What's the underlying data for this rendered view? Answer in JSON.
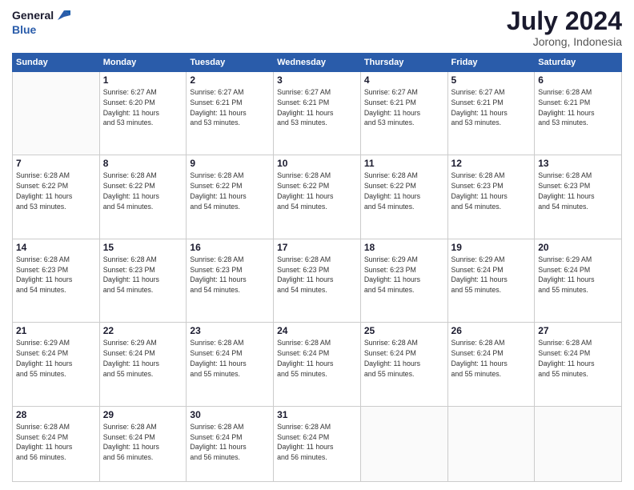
{
  "header": {
    "logo_line1": "General",
    "logo_line2": "Blue",
    "title": "July 2024",
    "subtitle": "Jorong, Indonesia"
  },
  "weekdays": [
    "Sunday",
    "Monday",
    "Tuesday",
    "Wednesday",
    "Thursday",
    "Friday",
    "Saturday"
  ],
  "weeks": [
    [
      {
        "day": "",
        "info": ""
      },
      {
        "day": "1",
        "info": "Sunrise: 6:27 AM\nSunset: 6:20 PM\nDaylight: 11 hours\nand 53 minutes."
      },
      {
        "day": "2",
        "info": "Sunrise: 6:27 AM\nSunset: 6:21 PM\nDaylight: 11 hours\nand 53 minutes."
      },
      {
        "day": "3",
        "info": "Sunrise: 6:27 AM\nSunset: 6:21 PM\nDaylight: 11 hours\nand 53 minutes."
      },
      {
        "day": "4",
        "info": "Sunrise: 6:27 AM\nSunset: 6:21 PM\nDaylight: 11 hours\nand 53 minutes."
      },
      {
        "day": "5",
        "info": "Sunrise: 6:27 AM\nSunset: 6:21 PM\nDaylight: 11 hours\nand 53 minutes."
      },
      {
        "day": "6",
        "info": "Sunrise: 6:28 AM\nSunset: 6:21 PM\nDaylight: 11 hours\nand 53 minutes."
      }
    ],
    [
      {
        "day": "7",
        "info": "Sunrise: 6:28 AM\nSunset: 6:22 PM\nDaylight: 11 hours\nand 53 minutes."
      },
      {
        "day": "8",
        "info": "Sunrise: 6:28 AM\nSunset: 6:22 PM\nDaylight: 11 hours\nand 54 minutes."
      },
      {
        "day": "9",
        "info": "Sunrise: 6:28 AM\nSunset: 6:22 PM\nDaylight: 11 hours\nand 54 minutes."
      },
      {
        "day": "10",
        "info": "Sunrise: 6:28 AM\nSunset: 6:22 PM\nDaylight: 11 hours\nand 54 minutes."
      },
      {
        "day": "11",
        "info": "Sunrise: 6:28 AM\nSunset: 6:22 PM\nDaylight: 11 hours\nand 54 minutes."
      },
      {
        "day": "12",
        "info": "Sunrise: 6:28 AM\nSunset: 6:23 PM\nDaylight: 11 hours\nand 54 minutes."
      },
      {
        "day": "13",
        "info": "Sunrise: 6:28 AM\nSunset: 6:23 PM\nDaylight: 11 hours\nand 54 minutes."
      }
    ],
    [
      {
        "day": "14",
        "info": "Sunrise: 6:28 AM\nSunset: 6:23 PM\nDaylight: 11 hours\nand 54 minutes."
      },
      {
        "day": "15",
        "info": "Sunrise: 6:28 AM\nSunset: 6:23 PM\nDaylight: 11 hours\nand 54 minutes."
      },
      {
        "day": "16",
        "info": "Sunrise: 6:28 AM\nSunset: 6:23 PM\nDaylight: 11 hours\nand 54 minutes."
      },
      {
        "day": "17",
        "info": "Sunrise: 6:28 AM\nSunset: 6:23 PM\nDaylight: 11 hours\nand 54 minutes."
      },
      {
        "day": "18",
        "info": "Sunrise: 6:29 AM\nSunset: 6:23 PM\nDaylight: 11 hours\nand 54 minutes."
      },
      {
        "day": "19",
        "info": "Sunrise: 6:29 AM\nSunset: 6:24 PM\nDaylight: 11 hours\nand 55 minutes."
      },
      {
        "day": "20",
        "info": "Sunrise: 6:29 AM\nSunset: 6:24 PM\nDaylight: 11 hours\nand 55 minutes."
      }
    ],
    [
      {
        "day": "21",
        "info": "Sunrise: 6:29 AM\nSunset: 6:24 PM\nDaylight: 11 hours\nand 55 minutes."
      },
      {
        "day": "22",
        "info": "Sunrise: 6:29 AM\nSunset: 6:24 PM\nDaylight: 11 hours\nand 55 minutes."
      },
      {
        "day": "23",
        "info": "Sunrise: 6:28 AM\nSunset: 6:24 PM\nDaylight: 11 hours\nand 55 minutes."
      },
      {
        "day": "24",
        "info": "Sunrise: 6:28 AM\nSunset: 6:24 PM\nDaylight: 11 hours\nand 55 minutes."
      },
      {
        "day": "25",
        "info": "Sunrise: 6:28 AM\nSunset: 6:24 PM\nDaylight: 11 hours\nand 55 minutes."
      },
      {
        "day": "26",
        "info": "Sunrise: 6:28 AM\nSunset: 6:24 PM\nDaylight: 11 hours\nand 55 minutes."
      },
      {
        "day": "27",
        "info": "Sunrise: 6:28 AM\nSunset: 6:24 PM\nDaylight: 11 hours\nand 55 minutes."
      }
    ],
    [
      {
        "day": "28",
        "info": "Sunrise: 6:28 AM\nSunset: 6:24 PM\nDaylight: 11 hours\nand 56 minutes."
      },
      {
        "day": "29",
        "info": "Sunrise: 6:28 AM\nSunset: 6:24 PM\nDaylight: 11 hours\nand 56 minutes."
      },
      {
        "day": "30",
        "info": "Sunrise: 6:28 AM\nSunset: 6:24 PM\nDaylight: 11 hours\nand 56 minutes."
      },
      {
        "day": "31",
        "info": "Sunrise: 6:28 AM\nSunset: 6:24 PM\nDaylight: 11 hours\nand 56 minutes."
      },
      {
        "day": "",
        "info": ""
      },
      {
        "day": "",
        "info": ""
      },
      {
        "day": "",
        "info": ""
      }
    ]
  ]
}
